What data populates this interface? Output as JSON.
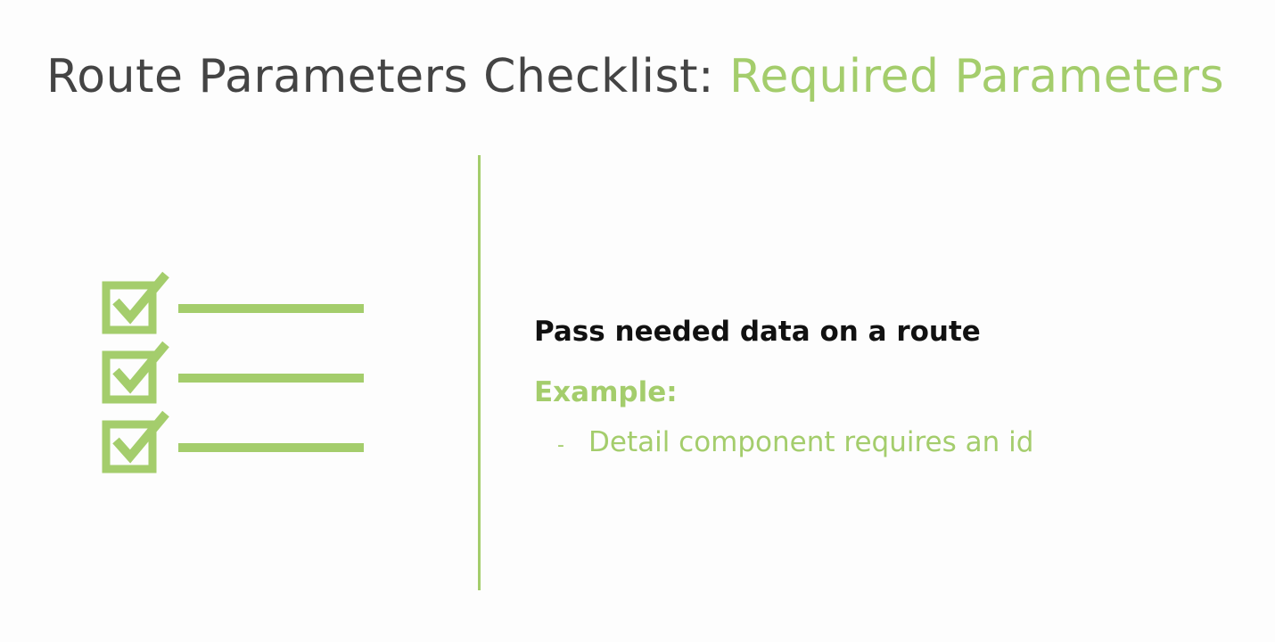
{
  "slide": {
    "title_main": "Route Parameters Checklist: ",
    "title_accent": "Required Parameters",
    "point": "Pass needed data on a route",
    "example_label": "Example:",
    "bullets": [
      {
        "dash": "-",
        "text": "Detail component requires an id"
      }
    ]
  },
  "icons": {
    "checklist": "checklist-icon",
    "checkbox": "checkbox-checked-icon"
  },
  "colors": {
    "accent": "#a4cd6c",
    "title": "#444444",
    "text": "#111111",
    "background": "#fdfdfd"
  }
}
